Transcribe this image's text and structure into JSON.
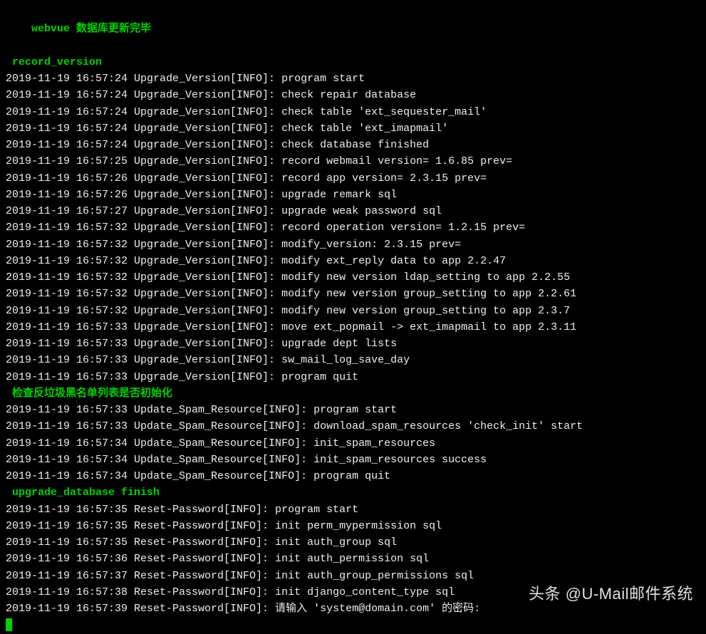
{
  "header1": {
    "prefix": "webvue ",
    "rest": "数据库更新完毕"
  },
  "header2": " record_version",
  "upgrade_lines": [
    "2019-11-19 16:57:24 Upgrade_Version[INFO]: program start",
    "2019-11-19 16:57:24 Upgrade_Version[INFO]: check repair database",
    "2019-11-19 16:57:24 Upgrade_Version[INFO]: check table 'ext_sequester_mail'",
    "2019-11-19 16:57:24 Upgrade_Version[INFO]: check table 'ext_imapmail'",
    "2019-11-19 16:57:24 Upgrade_Version[INFO]: check database finished",
    "2019-11-19 16:57:25 Upgrade_Version[INFO]: record webmail version= 1.6.85 prev=",
    "2019-11-19 16:57:26 Upgrade_Version[INFO]: record app version= 2.3.15 prev=",
    "2019-11-19 16:57:26 Upgrade_Version[INFO]: upgrade remark sql",
    "2019-11-19 16:57:27 Upgrade_Version[INFO]: upgrade weak password sql",
    "2019-11-19 16:57:32 Upgrade_Version[INFO]: record operation version= 1.2.15 prev=",
    "2019-11-19 16:57:32 Upgrade_Version[INFO]: modify_version: 2.3.15 prev=",
    "2019-11-19 16:57:32 Upgrade_Version[INFO]: modify ext_reply data to app 2.2.47",
    "2019-11-19 16:57:32 Upgrade_Version[INFO]: modify new version ldap_setting to app 2.2.55",
    "2019-11-19 16:57:32 Upgrade_Version[INFO]: modify new version group_setting to app 2.2.61",
    "2019-11-19 16:57:32 Upgrade_Version[INFO]: modify new version group_setting to app 2.3.7",
    "2019-11-19 16:57:33 Upgrade_Version[INFO]: move ext_popmail -> ext_imapmail to app 2.3.11",
    "2019-11-19 16:57:33 Upgrade_Version[INFO]: upgrade dept lists",
    "2019-11-19 16:57:33 Upgrade_Version[INFO]: sw_mail_log_save_day",
    "2019-11-19 16:57:33 Upgrade_Version[INFO]: program quit"
  ],
  "header3": " 检查反垃圾黑名单列表是否初始化",
  "spam_lines": [
    "2019-11-19 16:57:33 Update_Spam_Resource[INFO]: program start",
    "2019-11-19 16:57:33 Update_Spam_Resource[INFO]: download_spam_resources 'check_init' start",
    "2019-11-19 16:57:34 Update_Spam_Resource[INFO]: init_spam_resources",
    "2019-11-19 16:57:34 Update_Spam_Resource[INFO]: init_spam_resources success",
    "2019-11-19 16:57:34 Update_Spam_Resource[INFO]: program quit"
  ],
  "header4": " upgrade_database finish",
  "reset_lines": [
    "2019-11-19 16:57:35 Reset-Password[INFO]: program start",
    "2019-11-19 16:57:35 Reset-Password[INFO]: init perm_mypermission sql",
    "2019-11-19 16:57:35 Reset-Password[INFO]: init auth_group sql",
    "2019-11-19 16:57:36 Reset-Password[INFO]: init auth_permission sql",
    "2019-11-19 16:57:37 Reset-Password[INFO]: init auth_group_permissions sql",
    "2019-11-19 16:57:38 Reset-Password[INFO]: init django_content_type sql",
    "2019-11-19 16:57:39 Reset-Password[INFO]: 请输入 'system@domain.com' 的密码: "
  ],
  "watermark": "头条 @U-Mail邮件系统"
}
